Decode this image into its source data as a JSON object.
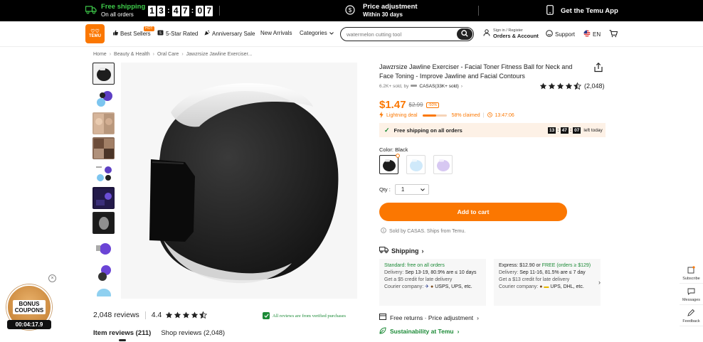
{
  "promo": {
    "free_shipping_title": "Free shipping",
    "free_shipping_sub": "On all orders",
    "countdown": [
      "1",
      "3",
      "4",
      "7",
      "0",
      "7"
    ],
    "price_adjust_title": "Price adjustment",
    "price_adjust_sub": "Within 30 days",
    "app_label": "Get the Temu App"
  },
  "nav": {
    "logo_text": "TEMU",
    "best_sellers": "Best Sellers",
    "hot_badge": "HOT",
    "five_star": "5-Star Rated",
    "anniversary": "Anniversary Sale",
    "new_arrivals": "New Arrivals",
    "categories": "Categories",
    "search_placeholder": "watermelon cutting tool",
    "signin_line1": "Sign in / Register",
    "signin_line2": "Orders & Account",
    "support": "Support",
    "lang": "EN"
  },
  "breadcrumb": [
    "Home",
    "Beauty & Health",
    "Oral Care",
    "Jawzrsize Jawline Exerciser..."
  ],
  "product": {
    "title": "Jawzrsize Jawline Exerciser - Facial Toner Fitness Ball for Neck and Face Toning - Improve Jawline and Facial Contours",
    "sold": "6.2K+ sold, by",
    "store": "CASAS(33K+ sold)",
    "rating_count": "(2,048)",
    "rating_value": 4.5,
    "price": "$1.47",
    "was_price": "$2.99",
    "discount": "-50%",
    "lightning": "Lightning deal",
    "claimed": "58% claimed",
    "claimed_fraction": 0.58,
    "deal_timer": "13:47:06",
    "free_ship_text": "Free shipping on all orders",
    "free_ship_cd": [
      "13",
      "47",
      "07"
    ],
    "left_today": "left today",
    "color_label": "Color: Black",
    "qty_label": "Qty :",
    "qty_value": "1",
    "add_to_cart": "Add to cart",
    "sold_by": "Sold by CASAS. Ships from Temu."
  },
  "shipping": {
    "heading": "Shipping",
    "standard": {
      "title": "Standard: free on all orders",
      "delivery_label": "Delivery:",
      "delivery": "Sep 13-19, 80.9% are ≤ 10 days",
      "credit": "Get a $5 credit for late delivery",
      "courier_label": "Courier company:",
      "courier": "USPS, UPS, etc."
    },
    "express": {
      "title_prefix": "Express: $12.90 or",
      "title_free": "FREE (orders ≥ $129)",
      "delivery_label": "Delivery:",
      "delivery": "Sep 11-16, 81.5% are ≤ 7 day",
      "credit": "Get a $13 credit for late delivery",
      "courier_label": "Courier company:",
      "courier": "UPS, DHL, etc."
    },
    "free_returns": "Free returns · Price adjustment",
    "sustainability": "Sustainability at Temu"
  },
  "reviews": {
    "count": "2,048 reviews",
    "rating": "4.4",
    "rating_value": 4.4,
    "verified": "All reviews are from verified purchases",
    "tab_item": "Item reviews (211)",
    "tab_shop": "Shop reviews (2,048)"
  },
  "widget": {
    "subscribe": "Subscribe",
    "messages": "Messages",
    "feedback": "Feedback"
  },
  "bonus": {
    "line1": "BONUS",
    "line2": "COUPONS",
    "timer": "00:04:17.9"
  },
  "colors": {
    "accent": "#fb7701",
    "green": "#1b8a36",
    "black": "#000000"
  }
}
